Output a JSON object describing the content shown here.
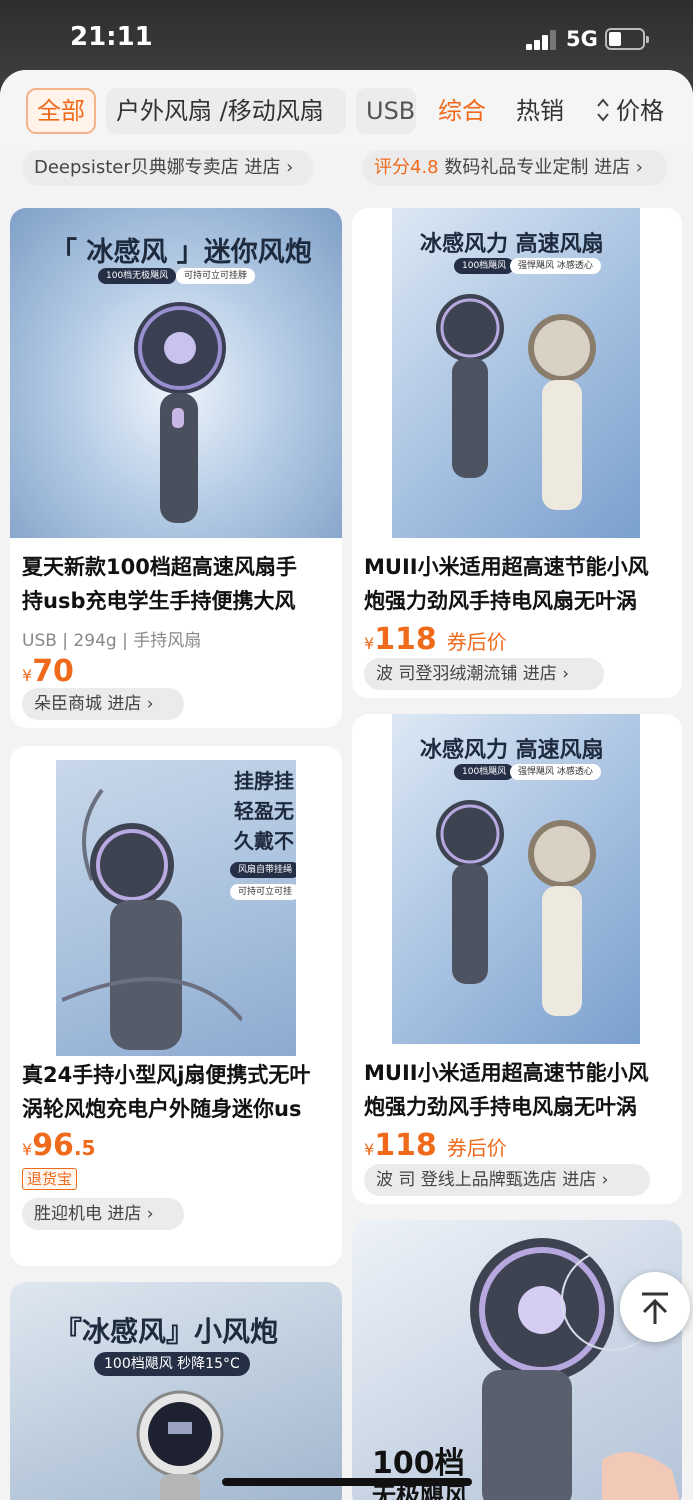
{
  "status": {
    "time": "21:11",
    "network": "5G"
  },
  "filters": {
    "chips": [
      "全部",
      "户外风扇 /移动风扇",
      "USB"
    ],
    "sort": [
      "综合",
      "热销",
      "价格"
    ]
  },
  "shops_top": {
    "left": "Deepsister贝典娜专卖店 进店 ›",
    "right_score": "评分4.8",
    "right": " 数码礼品专业定制 进店 ›"
  },
  "products": [
    {
      "image_headline": "「 冰感风 」迷你风炮",
      "image_tags": [
        "100档无极飓风",
        "可持可立可挂脖"
      ],
      "title_lines": [
        "夏天新款100档超高速风扇手",
        "持usb充电学生手持便携大风"
      ],
      "specs": "USB | 294g | 手持风扇",
      "price_int": "70",
      "currency": "¥",
      "shop": "朵臣商城 进店 ›"
    },
    {
      "image_headline": "冰感风力 高速风扇",
      "image_tags": [
        "100档飓风",
        "强悍飓风 冰感透心"
      ],
      "title_lines": [
        "MUII小米适用超高速节能小风",
        "炮强力劲风手持电风扇无叶涡"
      ],
      "price_int": "118",
      "currency": "¥",
      "price_note": "券后价",
      "shop": "波 司登羽绒潮流铺 进店 ›"
    },
    {
      "image_headline_lines": [
        "挂脖挂",
        "轻盈无",
        "久戴不"
      ],
      "image_tags": [
        "风扇自带挂绳",
        "可持可立可挂"
      ],
      "title_lines": [
        "真24手持小型风j扇便携式无叶",
        "涡轮风炮充电户外随身迷你us"
      ],
      "price_int": "96",
      "price_dec": ".5",
      "currency": "¥",
      "badge": "退货宝",
      "shop": "胜迎机电 进店 ›"
    },
    {
      "image_headline": "冰感风力 高速风扇",
      "image_tags": [
        "100档飓风",
        "强悍飓风 冰感透心"
      ],
      "title_lines": [
        "MUII小米适用超高速节能小风",
        "炮强力劲风手持电风扇无叶涡"
      ],
      "price_int": "118",
      "currency": "¥",
      "price_note": "券后价",
      "shop": "波 司 登线上品牌甄选店 进店 ›"
    },
    {
      "image_headline": "『冰感风』小风炮",
      "image_tags": [
        "100档飓风 秒降15°C"
      ]
    },
    {
      "image_headline_lines": [
        "100档",
        "无极飓风"
      ]
    }
  ],
  "icons": {
    "scroll_top": "arrow-up-to-top-icon"
  },
  "colors": {
    "accent": "#f06a1b"
  }
}
